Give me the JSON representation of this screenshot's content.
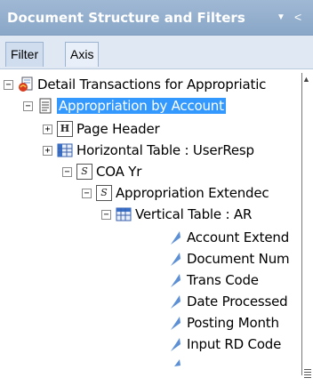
{
  "panel": {
    "title": "Document Structure and Filters",
    "dropdown_icon": "caret-down",
    "close_icon": "close-x"
  },
  "tabs": [
    {
      "label": "Filter"
    },
    {
      "label": "Axis"
    }
  ],
  "tree": [
    {
      "label": "Detail Transactions for Appropriatic",
      "icon": "report-document-icon",
      "expander": "−"
    },
    {
      "label": "Appropriation by Account",
      "icon": "report-page-icon",
      "expander": "−",
      "selected": true
    },
    {
      "label": "Page Header",
      "icon": "header-section-icon",
      "expander": "+"
    },
    {
      "label": "Horizontal Table : UserResp",
      "icon": "horizontal-table-icon",
      "expander": "+"
    },
    {
      "label": "COA Yr",
      "icon": "section-icon",
      "expander": "−"
    },
    {
      "label": "Appropriation Extendec",
      "icon": "section-icon",
      "expander": "−"
    },
    {
      "label": "Vertical Table : AR",
      "icon": "vertical-table-icon",
      "expander": "−"
    },
    {
      "label": "Account Extend",
      "icon": "column-cell-icon"
    },
    {
      "label": "Document Num",
      "icon": "column-cell-icon"
    },
    {
      "label": "Trans Code",
      "icon": "column-cell-icon"
    },
    {
      "label": "Date Processed",
      "icon": "column-cell-icon"
    },
    {
      "label": "Posting Month",
      "icon": "column-cell-icon"
    },
    {
      "label": "Input RD Code",
      "icon": "column-cell-icon"
    }
  ]
}
